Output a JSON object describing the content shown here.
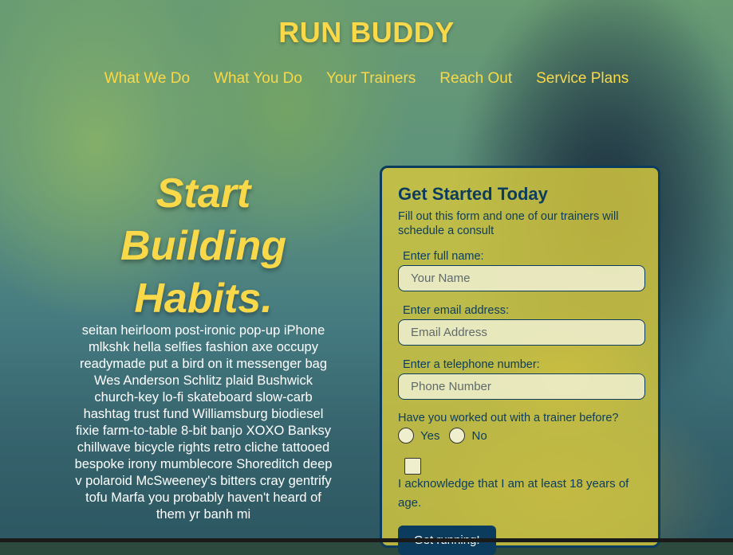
{
  "brand": "RUN BUDDY",
  "nav": [
    "What We Do",
    "What You Do",
    "Your Trainers",
    "Reach Out",
    "Service Plans"
  ],
  "hero": {
    "title_lines": [
      "Start",
      "Building",
      "Habits."
    ],
    "body": "seitan heirloom post-ironic pop-up iPhone mlkshk hella selfies fashion axe occupy readymade put a bird on it messenger bag Wes Anderson Schlitz plaid Bushwick church-key lo-fi skateboard slow-carb hashtag trust fund Williamsburg biodiesel fixie farm-to-table 8-bit banjo XOXO Banksy chillwave bicycle rights retro cliche tattooed bespoke irony mumblecore Shoreditch deep v polaroid McSweeney's bitters cray gentrify tofu Marfa you probably haven't heard of them yr banh mi"
  },
  "form": {
    "title": "Get Started Today",
    "subtitle": "Fill out this form and one of our trainers will schedule a consult",
    "name_label": "Enter full name:",
    "name_placeholder": "Your Name",
    "email_label": "Enter email address:",
    "email_placeholder": "Email Address",
    "phone_label": "Enter a telephone number:",
    "phone_placeholder": "Phone Number",
    "question": "Have you worked out with a trainer before?",
    "yes_label": "Yes",
    "no_label": "No",
    "ack_label": "I acknowledge that I am at least 18 years of age.",
    "submit_label": "Get running!"
  },
  "colors": {
    "accent": "#f9d949",
    "navy": "#0b3c5d",
    "card": "#d1c63f"
  }
}
